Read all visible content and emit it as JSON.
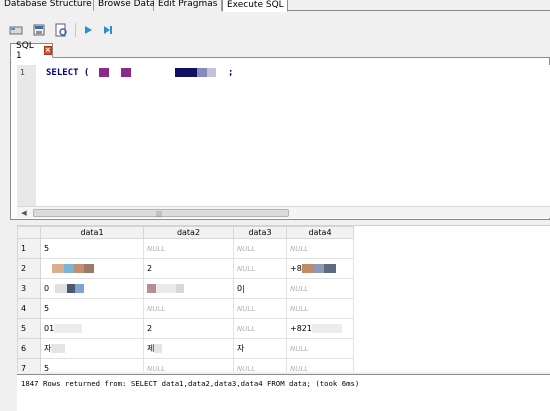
{
  "tabs": [
    "Database Structure",
    "Browse Data",
    "Edit Pragmas",
    "Execute SQL"
  ],
  "active_tab": "Execute SQL",
  "toolbar": {
    "icons": [
      "open-tab-icon",
      "open-sql-file-icon",
      "save-sql-file-icon",
      "execute-all-icon",
      "execute-line-icon"
    ]
  },
  "sql_tab": {
    "label": "SQL 1",
    "close": "×"
  },
  "editor": {
    "line_number": "1",
    "code": "SELECT (",
    "code_end": ";"
  },
  "results": {
    "columns": [
      "data1",
      "data2",
      "data3",
      "data4"
    ],
    "rows": [
      {
        "num": "1",
        "cells": [
          "5",
          "NULL",
          "NULL",
          "NULL"
        ]
      },
      {
        "num": "2",
        "cells": [
          "",
          "2",
          "NULL",
          "+8"
        ]
      },
      {
        "num": "3",
        "cells": [
          "0",
          "",
          "0|",
          "NULL"
        ]
      },
      {
        "num": "4",
        "cells": [
          "5",
          "NULL",
          "NULL",
          "NULL"
        ]
      },
      {
        "num": "5",
        "cells": [
          "01",
          "2",
          "NULL",
          "+821"
        ]
      },
      {
        "num": "6",
        "cells": [
          "자",
          "제",
          "자",
          "NULL"
        ]
      },
      {
        "num": "7",
        "cells": [
          "5",
          "NULL",
          "NULL",
          "NULL"
        ]
      }
    ]
  },
  "status": "1847 Rows returned from: SELECT data1,data2,data3,data4 FROM data; (took 6ms)"
}
